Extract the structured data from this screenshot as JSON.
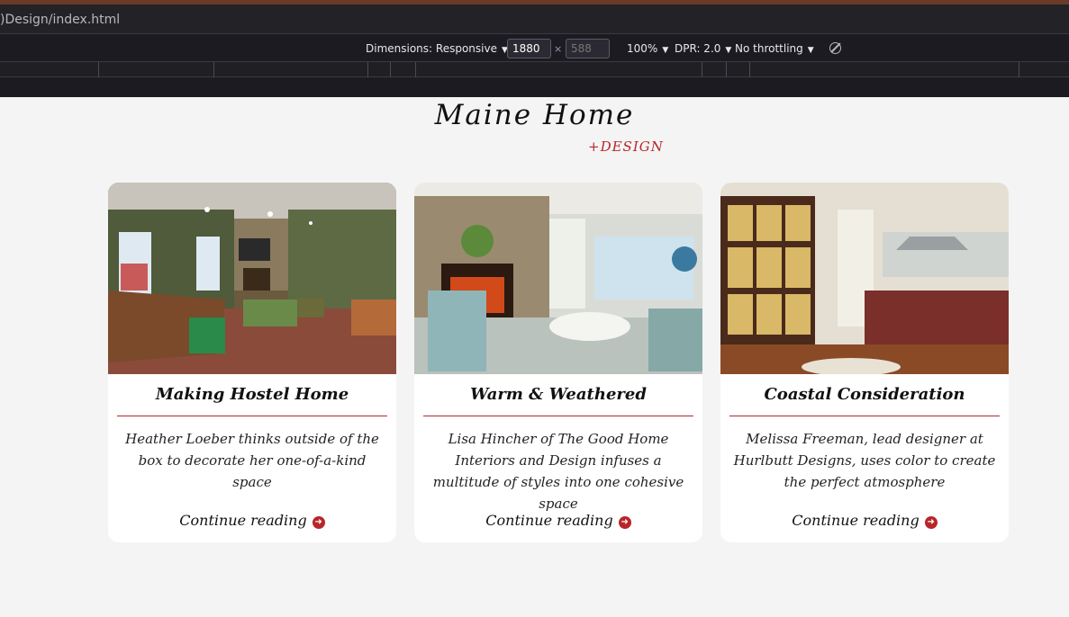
{
  "browser": {
    "url": ")Design/index.html",
    "dimensions_label": "Dimensions: Responsive",
    "width_value": "1880",
    "height_placeholder": "588",
    "times_sign": "×",
    "zoom_label": "100%",
    "dpr_label": "DPR: 2.0",
    "throttling_label": "No throttling",
    "caret": "▼"
  },
  "site": {
    "title": "Maine Home",
    "subtitle": "+DESIGN"
  },
  "articles": [
    {
      "title": "Making Hostel Home",
      "summary": "Heather Loeber thinks outside of the box to decorate her one-of-a-kind space",
      "link_label": "Continue reading"
    },
    {
      "title": "Warm & Weathered",
      "summary": "Lisa Hincher of The Good Home Interiors and Design infuses a multitude of styles into one cohesive space",
      "link_label": "Continue reading"
    },
    {
      "title": "Coastal Consideration",
      "summary": "Melissa Freeman, lead designer at Hurlbutt Designs, uses color to create the perfect atmosphere",
      "link_label": "Continue reading"
    }
  ],
  "colors": {
    "accent": "#b8262a",
    "page_bg": "#f4f4f4",
    "toolbar_bg": "#1c1b22"
  },
  "icons": {
    "continue": "arrow-circle-right-icon",
    "rotate": "rotate-viewport-icon"
  }
}
